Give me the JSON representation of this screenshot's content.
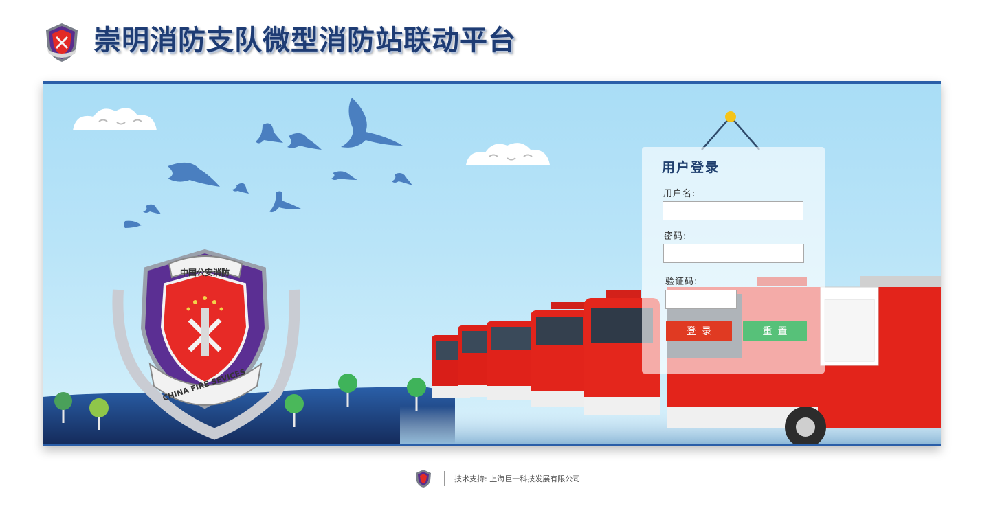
{
  "header": {
    "title": "崇明消防支队微型消防站联动平台",
    "logo_icon": "fire-service-emblem-icon"
  },
  "banner": {
    "badge_top_text": "中国公安消防",
    "badge_bottom_text": "CHINA FIRE SEVICES"
  },
  "login": {
    "title": "用户登录",
    "username_label": "用户名:",
    "username_value": "",
    "password_label": "密码:",
    "password_value": "",
    "captcha_label": "验证码:",
    "captcha_value": "",
    "login_button": "登录",
    "reset_button": "重置"
  },
  "footer": {
    "support_text": "技术支持: 上海巨一科技发展有限公司"
  },
  "colors": {
    "title": "#1e3c74",
    "banner_border": "#2a5ea8",
    "login_button": "#e03a22",
    "reset_button": "#57c179",
    "sky": "#b9e4f8"
  }
}
